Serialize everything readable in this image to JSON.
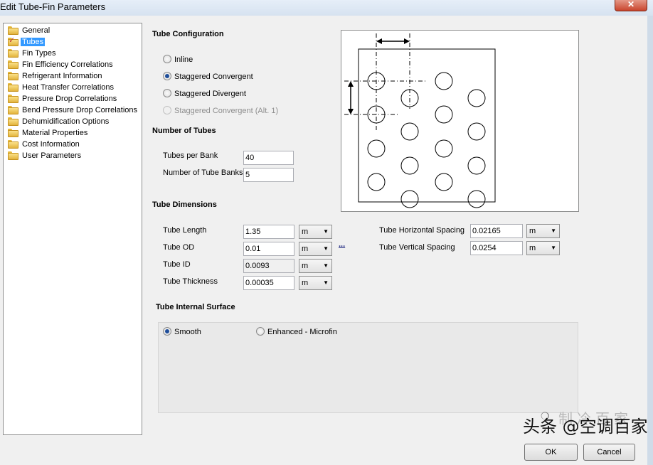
{
  "window": {
    "title": "Edit Tube-Fin Parameters",
    "close_glyph": "✕"
  },
  "tree": {
    "items": [
      {
        "label": "General"
      },
      {
        "label": "Tubes"
      },
      {
        "label": "Fin Types"
      },
      {
        "label": "Fin Efficiency Correlations"
      },
      {
        "label": "Refrigerant Information"
      },
      {
        "label": "Heat Transfer Correlations"
      },
      {
        "label": "Pressure Drop Correlations"
      },
      {
        "label": "Bend Pressure Drop Correlations"
      },
      {
        "label": "Dehumidification Options"
      },
      {
        "label": "Material Properties"
      },
      {
        "label": "Cost Information"
      },
      {
        "label": "User Parameters"
      }
    ],
    "selected": "Tubes"
  },
  "tube_configuration": {
    "heading": "Tube Configuration",
    "options": [
      {
        "label": "Inline",
        "checked": false,
        "disabled": false
      },
      {
        "label": "Staggered Convergent",
        "checked": true,
        "disabled": false
      },
      {
        "label": "Staggered Divergent",
        "checked": false,
        "disabled": false
      },
      {
        "label": "Staggered Convergent (Alt. 1)",
        "checked": false,
        "disabled": true
      }
    ]
  },
  "number_of_tubes": {
    "heading": "Number of Tubes",
    "tubes_per_bank": {
      "label": "Tubes per Bank",
      "value": "40"
    },
    "tube_banks": {
      "label": "Number of Tube Banks",
      "value": "5"
    }
  },
  "tube_dimensions": {
    "heading": "Tube Dimensions",
    "tube_length": {
      "label": "Tube Length",
      "value": "1.35",
      "unit": "m"
    },
    "tube_od": {
      "label": "Tube OD",
      "value": "0.01",
      "unit": "m"
    },
    "tube_id": {
      "label": "Tube ID",
      "value": "0.0093",
      "unit": "m"
    },
    "tube_thickness": {
      "label": "Tube Thickness",
      "value": "0.00035",
      "unit": "m"
    },
    "horizontal_spacing": {
      "label": "Tube Horizontal Spacing",
      "value": "0.02165",
      "unit": "m"
    },
    "vertical_spacing": {
      "label": "Tube Vertical Spacing",
      "value": "0.0254",
      "unit": "m"
    },
    "ellipsis_label": "..."
  },
  "internal_surface": {
    "heading": "Tube Internal Surface",
    "smooth": {
      "label": "Smooth",
      "checked": true
    },
    "enhanced": {
      "label": "Enhanced - Microfin",
      "checked": false
    }
  },
  "buttons": {
    "ok": "OK",
    "cancel": "Cancel"
  },
  "watermark": {
    "text": "头条 @空调百家",
    "faint_text": "制冷百家"
  }
}
